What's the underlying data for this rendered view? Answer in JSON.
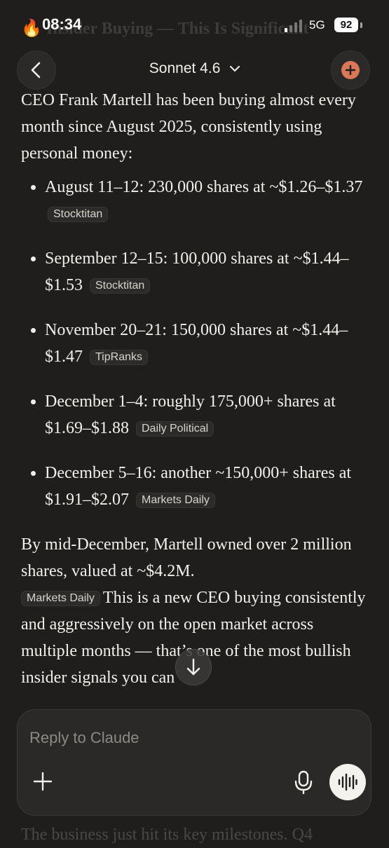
{
  "status_bar": {
    "time": "08:34",
    "network": "5G",
    "battery": "92"
  },
  "header": {
    "model_name": "Sonnet 4.6",
    "ghost_heading": "🔥 Insider Buying — This Is Significant"
  },
  "message": {
    "intro": "CEO Frank Martell has been buying almost every month since August 2025, consistently using personal money:",
    "purchases": [
      {
        "text": "August 11–12: 230,000 shares at ~$1.26–$1.37",
        "source": "Stocktitan"
      },
      {
        "text": "September 12–15: 100,000 shares at ~$1.44–$1.53",
        "source": "Stocktitan"
      },
      {
        "text": "November 20–21: 150,000 shares at ~$1.44–$1.47",
        "source": "TipRanks"
      },
      {
        "text": "December 1–4: roughly 175,000+ shares at $1.69–$1.88",
        "source": "Daily Political"
      },
      {
        "text": "December 5–16: another ~150,000+ shares at $1.91–$2.07",
        "source": "Markets Daily"
      }
    ],
    "summary_part1": "By mid-December, Martell owned over 2 million shares, valued at ~$4.2M.",
    "summary_source": "Markets Daily",
    "summary_part2": "This is a new CEO buying consistently and aggressively on the open market across multiple months — that’s one of the most bullish insider signals you can",
    "ghost_next": "The business just hit its key milestones. Q4"
  },
  "composer": {
    "placeholder": "Reply to Claude"
  },
  "icons": {
    "back": "chevron-left-icon",
    "model_menu": "chevron-down-icon",
    "new_chat": "plus-circle-icon",
    "scroll": "arrow-down-icon",
    "attach": "plus-icon",
    "mic": "microphone-icon",
    "voice": "voice-waveform-icon"
  },
  "colors": {
    "background": "#1f1e1d",
    "accent": "#d97757",
    "text": "#f2f0ea"
  }
}
